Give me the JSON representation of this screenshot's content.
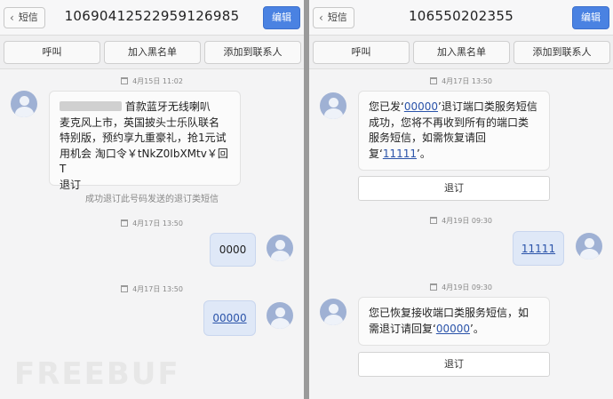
{
  "left": {
    "back_label": "短信",
    "title": "10690412522959126985",
    "edit_label": "编辑",
    "actions": [
      "呼叫",
      "加入黑名单",
      "添加到联系人"
    ],
    "messages": [
      {
        "time": "4月15日 11:02",
        "text_after_blur": "首款蓝牙无线喇叭",
        "lines": [
          "麦克风上市，英国披头士乐队联名",
          "特别版，预约享九重豪礼，抢1元试",
          "用机会 淘口令￥tNkZ0IbXMtv￥回T",
          "退订"
        ]
      },
      {
        "note": "成功退订此号码发送的退订类短信"
      },
      {
        "time": "4月17日 13:50",
        "text": "0000"
      },
      {
        "time": "4月17日 13:50",
        "text": "00000"
      }
    ]
  },
  "right": {
    "back_label": "短信",
    "title": "106550202355",
    "edit_label": "编辑",
    "actions": [
      "呼叫",
      "加入黑名单",
      "添加到联系人"
    ],
    "messages": [
      {
        "time": "4月17日 13:50",
        "l1a": "您已发‘",
        "l1link": "00000",
        "l1b": "’退订端口类服务短信",
        "l2": "成功，您将不再收到所有的端口类",
        "l3": "服务短信，如需恢复请回",
        "l4a": "复‘",
        "l4link": "11111",
        "l4b": "’。",
        "button": "退订"
      },
      {
        "time": "4月19日 09:30",
        "text": "11111"
      },
      {
        "time": "4月19日 09:30",
        "l1": "您已恢复接收端口类服务短信，如",
        "l2a": "需退订请回复‘",
        "l2link": "00000",
        "l2b": "’。",
        "button": "退订"
      }
    ]
  },
  "watermark": "FREEBUF"
}
